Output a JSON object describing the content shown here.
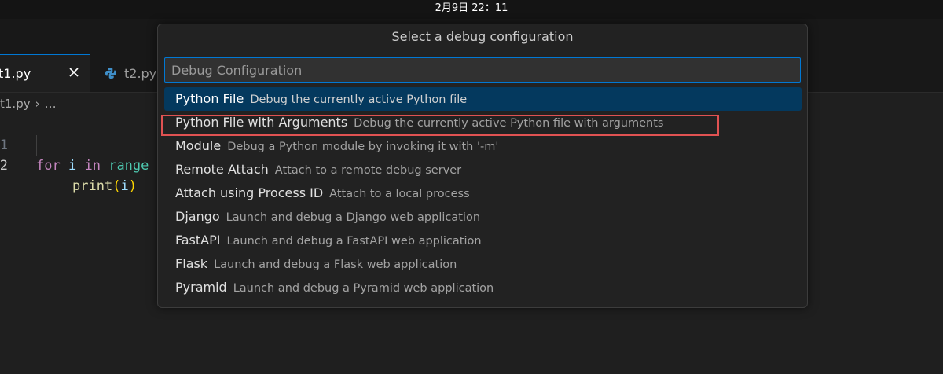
{
  "system": {
    "clock": "2月9日  22：11"
  },
  "tabs": [
    {
      "label": "t1.py",
      "active": true
    },
    {
      "label": "t2.py",
      "active": false
    }
  ],
  "breadcrumb": {
    "file": "t1.py",
    "ellipsis": "…"
  },
  "editor": {
    "lines": [
      {
        "number": "1",
        "tokens": [
          "for",
          " ",
          "i",
          " ",
          "in",
          " ",
          "range"
        ]
      },
      {
        "number": "2",
        "tokens": [
          "print",
          "(",
          "i",
          ")"
        ]
      }
    ]
  },
  "quick_pick": {
    "title": "Select a debug configuration",
    "input_placeholder": "Debug Configuration",
    "items": [
      {
        "label": "Python File",
        "description": "Debug the currently active Python file",
        "selected": true
      },
      {
        "label": "Python File with Arguments",
        "description": "Debug the currently active Python file with arguments",
        "highlighted": true
      },
      {
        "label": "Module",
        "description": "Debug a Python module by invoking it with '-m'"
      },
      {
        "label": "Remote Attach",
        "description": "Attach to a remote debug server"
      },
      {
        "label": "Attach using Process ID",
        "description": "Attach to a local process"
      },
      {
        "label": "Django",
        "description": "Launch and debug a Django web application"
      },
      {
        "label": "FastAPI",
        "description": "Launch and debug a FastAPI web application"
      },
      {
        "label": "Flask",
        "description": "Launch and debug a Flask web application"
      },
      {
        "label": "Pyramid",
        "description": "Launch and debug a Pyramid web application"
      }
    ]
  },
  "icons": {
    "tab_close": "close-icon",
    "file_type": "python-file-icon",
    "breadcrumb_separator": "chevron-right-icon"
  },
  "colors": {
    "accent": "#0078d4",
    "selection": "#04395e",
    "highlight_box": "#e05252",
    "background": "#1f1f1f"
  }
}
